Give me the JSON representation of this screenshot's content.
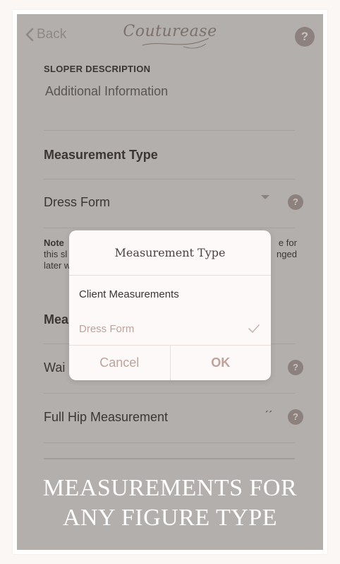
{
  "header": {
    "back_label": "Back",
    "logo_text": "Couturease",
    "help_glyph": "?"
  },
  "form": {
    "section_label": "SLOPER DESCRIPTION",
    "info_text": "Additional Information",
    "measurement_type_title": "Measurement Type",
    "measurement_type_value": "Dress Form",
    "note_bold": "Note",
    "note_line1_end": "e for",
    "note_line2_start": "this sl",
    "note_line2_end": "nged",
    "note_line3_start": "later w",
    "measurements_title_partial": "Mea",
    "waist_partial": "Wai",
    "full_hip_label": "Full Hip Measurement",
    "inch_mark": "´´",
    "help_glyph": "?"
  },
  "dialog": {
    "title": "Measurement Type",
    "options": [
      "Client Measurements",
      "Dress Form"
    ],
    "selected_option": "Dress Form",
    "cancel_label": "Cancel",
    "ok_label": "OK"
  },
  "banner": {
    "line1": "MEASUREMENTS FOR",
    "line2": "ANY FIGURE TYPE"
  },
  "colors": {
    "overlay": "#b3afad",
    "accent": "#bfa29a",
    "icon_bg": "#8d817d"
  }
}
